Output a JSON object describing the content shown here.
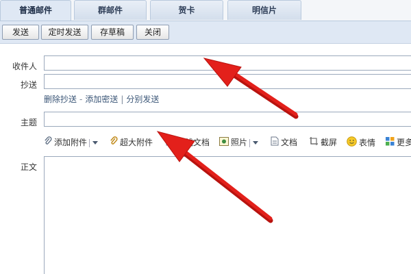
{
  "tabs": [
    {
      "label": "普通邮件",
      "active": true
    },
    {
      "label": "群邮件",
      "active": false
    },
    {
      "label": "贺卡",
      "active": false
    },
    {
      "label": "明信片",
      "active": false
    }
  ],
  "toolbar": {
    "send": "发送",
    "scheduled_send": "定时发送",
    "save_draft": "存草稿",
    "close": "关闭"
  },
  "form": {
    "recipient_label": "收件人",
    "cc_label": "抄送",
    "cc_links": {
      "delete_cc": "删除抄送",
      "dash": "-",
      "add_bcc": "添加密送",
      "divider": "|",
      "separate_send": "分别发送"
    },
    "subject_label": "主题",
    "body_label": "正文",
    "recipient_value": "",
    "cc_value": "",
    "subject_value": ""
  },
  "attachments": {
    "add_attachment": "添加附件",
    "large_attachment": "超大附件",
    "online_doc": "在线文档",
    "photo": "照片",
    "document": "文档",
    "screenshot": "截屏",
    "emoji": "表情",
    "more": "更多"
  },
  "colors": {
    "arrow": "#e3201b",
    "tab_bar": "#dfe8f4",
    "link": "#3b5677"
  },
  "icons": [
    "paperclip-icon",
    "large-attachment-icon",
    "online-doc-icon",
    "photo-icon",
    "document-icon",
    "screenshot-icon",
    "emoji-icon",
    "more-icon"
  ]
}
